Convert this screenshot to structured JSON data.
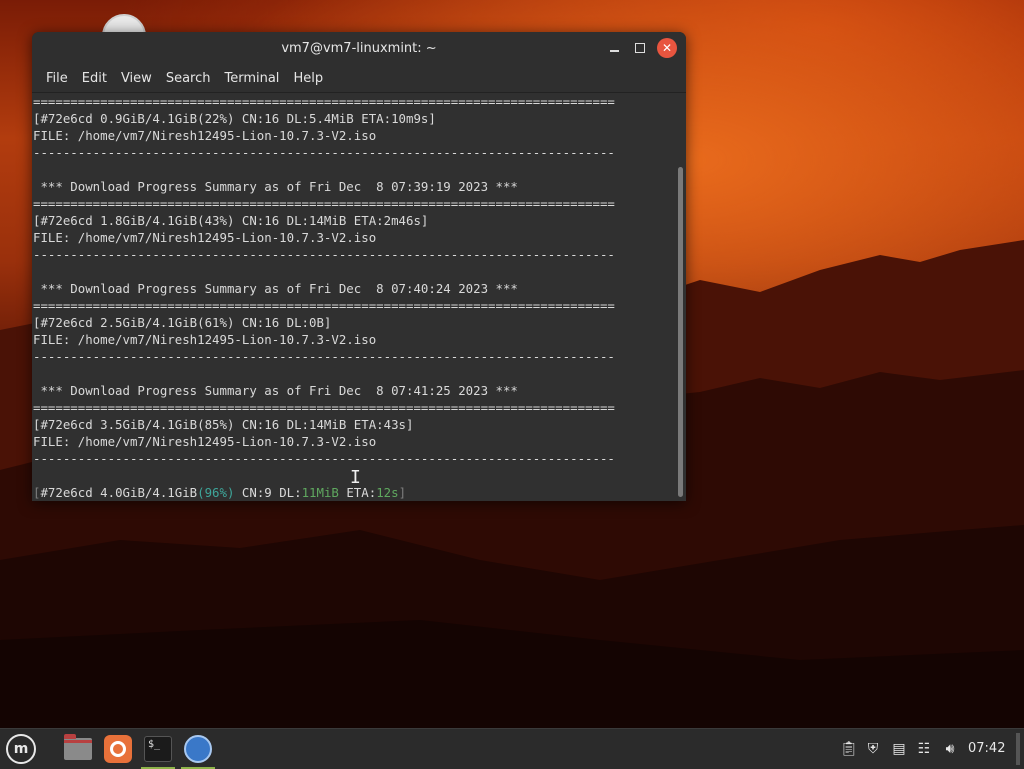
{
  "window": {
    "title": "vm7@vm7-linuxmint: ~",
    "minimize_icon": "minimize-icon",
    "maximize_icon": "maximize-icon",
    "close_icon": "close-icon",
    "close_glyph": "✕"
  },
  "menubar": {
    "items": [
      "File",
      "Edit",
      "View",
      "Search",
      "Terminal",
      "Help"
    ]
  },
  "terminal": {
    "lines": [
      {
        "segments": [
          {
            "text": "==============================================================================",
            "style": ""
          }
        ]
      },
      {
        "segments": [
          {
            "text": "[#72e6cd 0.9GiB/4.1GiB(22%) CN:16 DL:5.4MiB ETA:10m9s]",
            "style": ""
          }
        ]
      },
      {
        "segments": [
          {
            "text": "FILE: /home/vm7/Niresh12495-Lion-10.7.3-V2.iso",
            "style": ""
          }
        ]
      },
      {
        "segments": [
          {
            "text": "------------------------------------------------------------------------------",
            "style": ""
          }
        ]
      },
      {
        "segments": [
          {
            "text": "",
            "style": ""
          }
        ]
      },
      {
        "segments": [
          {
            "text": " *** Download Progress Summary as of Fri Dec  8 07:39:19 2023 ***",
            "style": ""
          }
        ]
      },
      {
        "segments": [
          {
            "text": "==============================================================================",
            "style": ""
          }
        ]
      },
      {
        "segments": [
          {
            "text": "[#72e6cd 1.8GiB/4.1GiB(43%) CN:16 DL:14MiB ETA:2m46s]",
            "style": ""
          }
        ]
      },
      {
        "segments": [
          {
            "text": "FILE: /home/vm7/Niresh12495-Lion-10.7.3-V2.iso",
            "style": ""
          }
        ]
      },
      {
        "segments": [
          {
            "text": "------------------------------------------------------------------------------",
            "style": ""
          }
        ]
      },
      {
        "segments": [
          {
            "text": "",
            "style": ""
          }
        ]
      },
      {
        "segments": [
          {
            "text": " *** Download Progress Summary as of Fri Dec  8 07:40:24 2023 ***",
            "style": ""
          }
        ]
      },
      {
        "segments": [
          {
            "text": "==============================================================================",
            "style": ""
          }
        ]
      },
      {
        "segments": [
          {
            "text": "[#72e6cd 2.5GiB/4.1GiB(61%) CN:16 DL:0B]",
            "style": ""
          }
        ]
      },
      {
        "segments": [
          {
            "text": "FILE: /home/vm7/Niresh12495-Lion-10.7.3-V2.iso",
            "style": ""
          }
        ]
      },
      {
        "segments": [
          {
            "text": "------------------------------------------------------------------------------",
            "style": ""
          }
        ]
      },
      {
        "segments": [
          {
            "text": "",
            "style": ""
          }
        ]
      },
      {
        "segments": [
          {
            "text": " *** Download Progress Summary as of Fri Dec  8 07:41:25 2023 ***",
            "style": ""
          }
        ]
      },
      {
        "segments": [
          {
            "text": "==============================================================================",
            "style": ""
          }
        ]
      },
      {
        "segments": [
          {
            "text": "[#72e6cd 3.5GiB/4.1GiB(85%) CN:16 DL:14MiB ETA:43s]",
            "style": ""
          }
        ]
      },
      {
        "segments": [
          {
            "text": "FILE: /home/vm7/Niresh12495-Lion-10.7.3-V2.iso",
            "style": ""
          }
        ]
      },
      {
        "segments": [
          {
            "text": "------------------------------------------------------------------------------",
            "style": ""
          }
        ]
      },
      {
        "segments": [
          {
            "text": "",
            "style": ""
          }
        ]
      },
      {
        "segments": [
          {
            "text": "[",
            "style": "dim"
          },
          {
            "text": "#72e6cd 4.0GiB/4.1GiB",
            "style": ""
          },
          {
            "text": "(96%)",
            "style": "teal"
          },
          {
            "text": " CN:9 DL:",
            "style": ""
          },
          {
            "text": "11MiB",
            "style": "green"
          },
          {
            "text": " ETA:",
            "style": ""
          },
          {
            "text": "12s",
            "style": "green"
          },
          {
            "text": "]",
            "style": "dim"
          }
        ]
      }
    ]
  },
  "taskbar": {
    "menu_icon": "linux-mint-menu-icon",
    "apps": [
      {
        "name": "files-icon",
        "state": "normal"
      },
      {
        "name": "firefox-icon",
        "state": "normal"
      },
      {
        "name": "terminal-icon",
        "state": "active"
      },
      {
        "name": "web-browser-icon",
        "state": "running"
      }
    ],
    "tray": [
      "clipboard-icon",
      "shield-icon",
      "update-manager-icon",
      "network-icon",
      "volume-icon"
    ],
    "clock": "07:42"
  },
  "colors": {
    "terminal_bg": "#303030",
    "titlebar_bg": "#2f2f2f",
    "close_button": "#e8553f",
    "progress_green": "#5fa85f",
    "progress_teal": "#3ea69a",
    "taskbar_bg": "#2b2b2b"
  }
}
